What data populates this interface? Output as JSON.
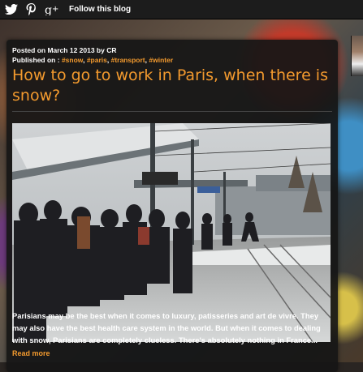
{
  "topbar": {
    "icons": [
      "twitter-icon",
      "pinterest-icon",
      "google-plus-icon"
    ],
    "follow_label": "Follow this blog"
  },
  "post": {
    "posted_on": "Posted on March 12 2013 by CR",
    "published_prefix": "Published on :",
    "tags": [
      "#snow",
      "#paris",
      "#transport",
      "#winter"
    ],
    "title": "How to go to work in Paris, when there is snow?",
    "image_alt": "Snowy tram station in Paris",
    "excerpt": "Parisians may be the best when it comes to luxury, patisseries and art de vivre. They may also have the best health care system in the world. But when it comes to dealing with snow, Parisians are completely clueless. There's absolutely nothing in France...",
    "read_more": "Read more"
  },
  "colors": {
    "accent": "#f39a2e",
    "card": "#161616",
    "topbar": "#1c1c1c"
  }
}
